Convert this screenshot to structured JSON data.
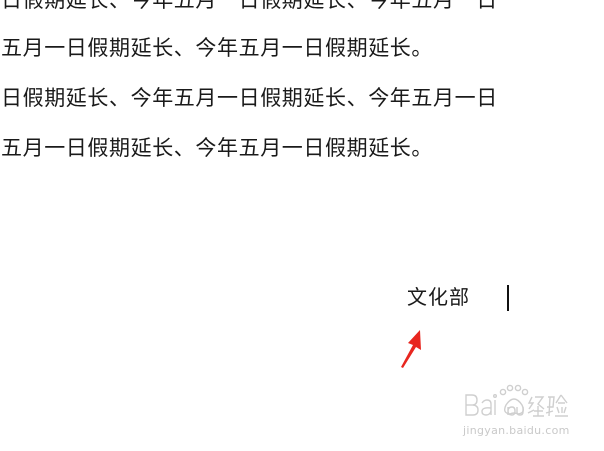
{
  "document": {
    "lines": [
      "日假期延长、今年五月一日假期延长、今年五月一日",
      "五月一日假期延长、今年五月一日假期延长。",
      "日假期延长、今年五月一日假期延长、今年五月一日",
      "五月一日假期延长、今年五月一日假期延长。"
    ],
    "signature": "文化部"
  },
  "annotation": {
    "arrow_color": "#e8261f",
    "arrow_icon": "red-pointer-arrow-icon"
  },
  "watermark": {
    "logo_text": "Baidu经验",
    "url": "jingyan.baidu.com",
    "color": "#c9c9c9"
  }
}
